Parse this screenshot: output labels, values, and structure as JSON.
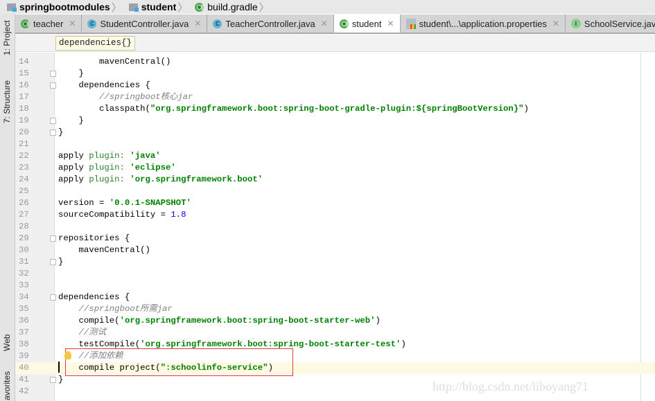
{
  "breadcrumb": [
    {
      "label": "springbootmodules",
      "bold": true,
      "icon": "folder-icon"
    },
    {
      "label": "student",
      "bold": true,
      "icon": "folder-icon"
    },
    {
      "label": "build.gradle",
      "bold": false,
      "icon": "gradle-icon"
    }
  ],
  "left_tools": {
    "project": "1: Project",
    "structure": "7: Structure",
    "web": "Web",
    "favorites": "avorites"
  },
  "tabs": [
    {
      "label": "teacher",
      "icon": "gradle",
      "active": false,
      "close": "✕"
    },
    {
      "label": "StudentController.java",
      "icon": "class",
      "active": false,
      "close": "✕"
    },
    {
      "label": "TeacherController.java",
      "icon": "class",
      "active": false,
      "close": "✕"
    },
    {
      "label": "student",
      "icon": "gradle",
      "active": true,
      "close": "✕"
    },
    {
      "label": "student\\...\\application.properties",
      "icon": "properties",
      "active": false,
      "close": "✕"
    },
    {
      "label": "SchoolService.java",
      "icon": "interface",
      "active": false,
      "close": ""
    }
  ],
  "tooltip": "dependencies{}",
  "code": [
    {
      "n": "14",
      "segs": [
        [
          "        mavenCentral()",
          ""
        ]
      ]
    },
    {
      "n": "15",
      "segs": [
        [
          "    }",
          ""
        ]
      ],
      "fold": true
    },
    {
      "n": "16",
      "segs": [
        [
          "    dependencies {",
          ""
        ]
      ],
      "fold": true
    },
    {
      "n": "17",
      "segs": [
        [
          "        ",
          ""
        ],
        [
          "//springboot核心jar",
          "c"
        ]
      ]
    },
    {
      "n": "18",
      "segs": [
        [
          "        classpath(",
          ""
        ],
        [
          "\"org.springframework.boot:spring-boot-gradle-plugin:${springBootVersion}\"",
          "s"
        ],
        [
          ")",
          ""
        ]
      ]
    },
    {
      "n": "19",
      "segs": [
        [
          "    }",
          ""
        ]
      ],
      "fold": true
    },
    {
      "n": "20",
      "segs": [
        [
          "}",
          ""
        ]
      ],
      "fold": true
    },
    {
      "n": "21",
      "segs": []
    },
    {
      "n": "22",
      "segs": [
        [
          "apply ",
          ""
        ],
        [
          "plugin:",
          "p"
        ],
        [
          " ",
          ""
        ],
        [
          "'java'",
          "s"
        ]
      ]
    },
    {
      "n": "23",
      "segs": [
        [
          "apply ",
          ""
        ],
        [
          "plugin:",
          "p"
        ],
        [
          " ",
          ""
        ],
        [
          "'eclipse'",
          "s"
        ]
      ]
    },
    {
      "n": "24",
      "segs": [
        [
          "apply ",
          ""
        ],
        [
          "plugin:",
          "p"
        ],
        [
          " ",
          ""
        ],
        [
          "'org.springframework.boot'",
          "s"
        ]
      ]
    },
    {
      "n": "25",
      "segs": []
    },
    {
      "n": "26",
      "segs": [
        [
          "version = ",
          ""
        ],
        [
          "'0.0.1-SNAPSHOT'",
          "s"
        ]
      ]
    },
    {
      "n": "27",
      "segs": [
        [
          "sourceCompatibility = ",
          ""
        ],
        [
          "1.8",
          "n"
        ]
      ]
    },
    {
      "n": "28",
      "segs": []
    },
    {
      "n": "29",
      "segs": [
        [
          "repositories {",
          ""
        ]
      ],
      "fold": true
    },
    {
      "n": "30",
      "segs": [
        [
          "    mavenCentral()",
          ""
        ]
      ]
    },
    {
      "n": "31",
      "segs": [
        [
          "}",
          ""
        ]
      ],
      "fold": true
    },
    {
      "n": "32",
      "segs": []
    },
    {
      "n": "33",
      "segs": []
    },
    {
      "n": "34",
      "segs": [
        [
          "dependencies {",
          ""
        ]
      ],
      "fold": true
    },
    {
      "n": "35",
      "segs": [
        [
          "    ",
          ""
        ],
        [
          "//springboot所需jar",
          "c"
        ]
      ]
    },
    {
      "n": "36",
      "segs": [
        [
          "    compile(",
          ""
        ],
        [
          "'org.springframework.boot:spring-boot-starter-web'",
          "s"
        ],
        [
          ")",
          ""
        ]
      ]
    },
    {
      "n": "37",
      "segs": [
        [
          "    ",
          ""
        ],
        [
          "//测试",
          "c"
        ]
      ]
    },
    {
      "n": "38",
      "segs": [
        [
          "    testCompile(",
          ""
        ],
        [
          "'org.springframework.boot:spring-boot-starter-test'",
          "s"
        ],
        [
          ")",
          ""
        ]
      ]
    },
    {
      "n": "39",
      "segs": [
        [
          "    ",
          ""
        ],
        [
          "//添加依赖",
          "c"
        ]
      ]
    },
    {
      "n": "40",
      "segs": [
        [
          "    compile project(",
          ""
        ],
        [
          "\":schoolinfo-service\"",
          "s"
        ],
        [
          ")",
          ""
        ]
      ],
      "current": true
    },
    {
      "n": "41",
      "segs": [
        [
          "}",
          ""
        ]
      ],
      "fold": true
    },
    {
      "n": "42",
      "segs": []
    }
  ],
  "watermark": "http://blog.csdn.net/liboyang71",
  "colors": {
    "string": "#008000",
    "comment": "#808080",
    "number": "#0000ff",
    "highlight_box": "#e53935",
    "current_line": "#fdf9e3"
  }
}
